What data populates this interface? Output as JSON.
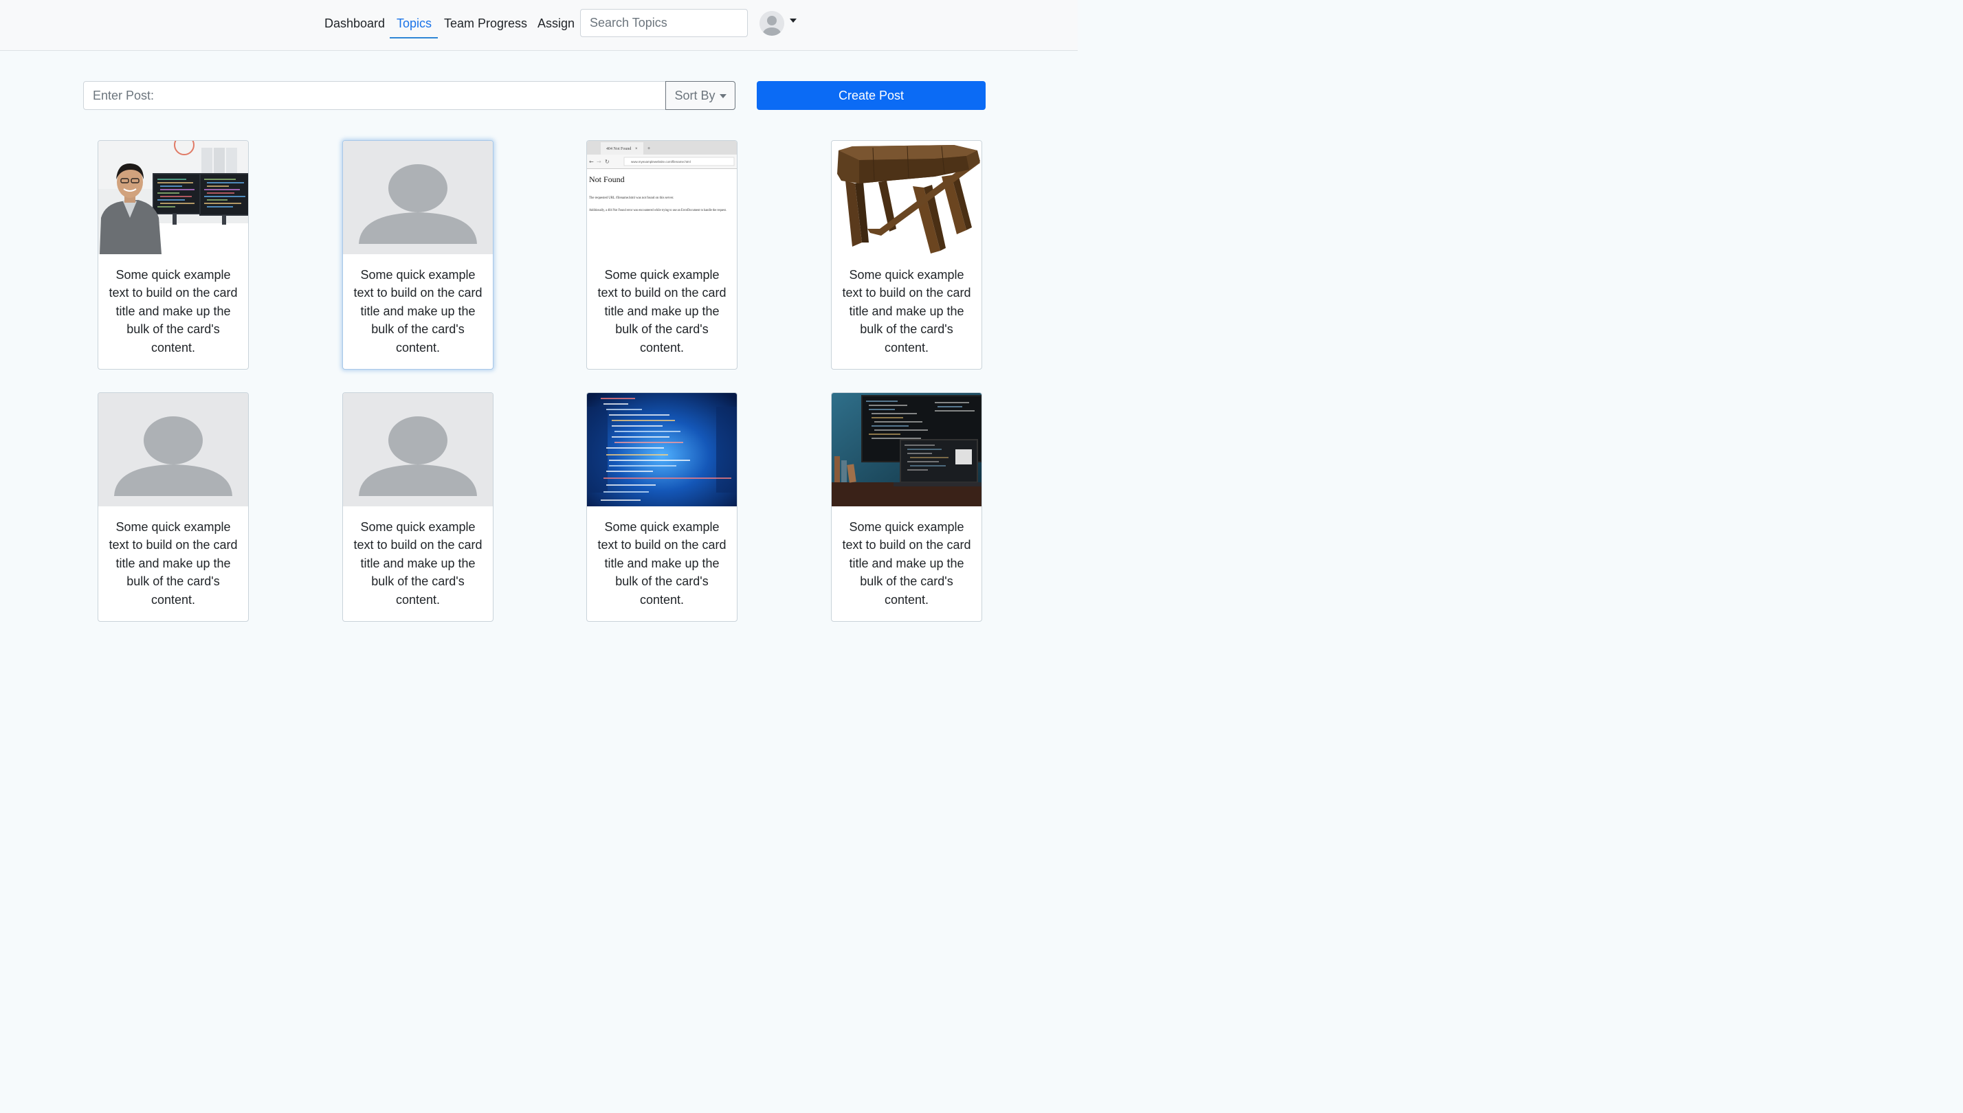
{
  "navbar": {
    "links": [
      {
        "label": "Dashboard",
        "active": false
      },
      {
        "label": "Topics",
        "active": true
      },
      {
        "label": "Team Progress",
        "active": false
      },
      {
        "label": "Assign",
        "active": false
      }
    ],
    "search_placeholder": "Search Topics",
    "active_color": "#1a73e8"
  },
  "toolbar": {
    "post_placeholder": "Enter Post:",
    "sort_label": "Sort By",
    "create_label": "Create Post",
    "create_color": "#0b6bf5"
  },
  "cards": [
    {
      "image": "man-at-desk-with-monitors",
      "text": "Some quick example text to build on the card title and make up the bulk of the card's content."
    },
    {
      "image": "placeholder-person-icon",
      "text": "Some quick example text to build on the card title and make up the bulk of the card's content."
    },
    {
      "image": "browser-404-screenshot",
      "text": "Some quick example text to build on the card title and make up the bulk of the card's content."
    },
    {
      "image": "wooden-stool-3d",
      "text": "Some quick example text to build on the card title and make up the bulk of the card's content."
    },
    {
      "image": "placeholder-person-icon",
      "text": "Some quick example text to build on the card title and make up the bulk of the card's content."
    },
    {
      "image": "placeholder-person-icon",
      "text": "Some quick example text to build on the card title and make up the bulk of the card's content."
    },
    {
      "image": "blue-code-screen",
      "text": "Some quick example text to build on the card title and make up the bulk of the card's content."
    },
    {
      "image": "dark-code-monitors",
      "text": "Some quick example text to build on the card title and make up the bulk of the card's content."
    }
  ],
  "screenshot_404": {
    "tab": "404 Not Found",
    "url": "www.myexamplewebsite.com/filename.html",
    "heading": "Not Found",
    "line1": "The requested URL /filename.html was not found on this server.",
    "line2": "Additionally, a 404 Not Found error was encountered while trying to use an ErrorDocument to handle the request."
  }
}
